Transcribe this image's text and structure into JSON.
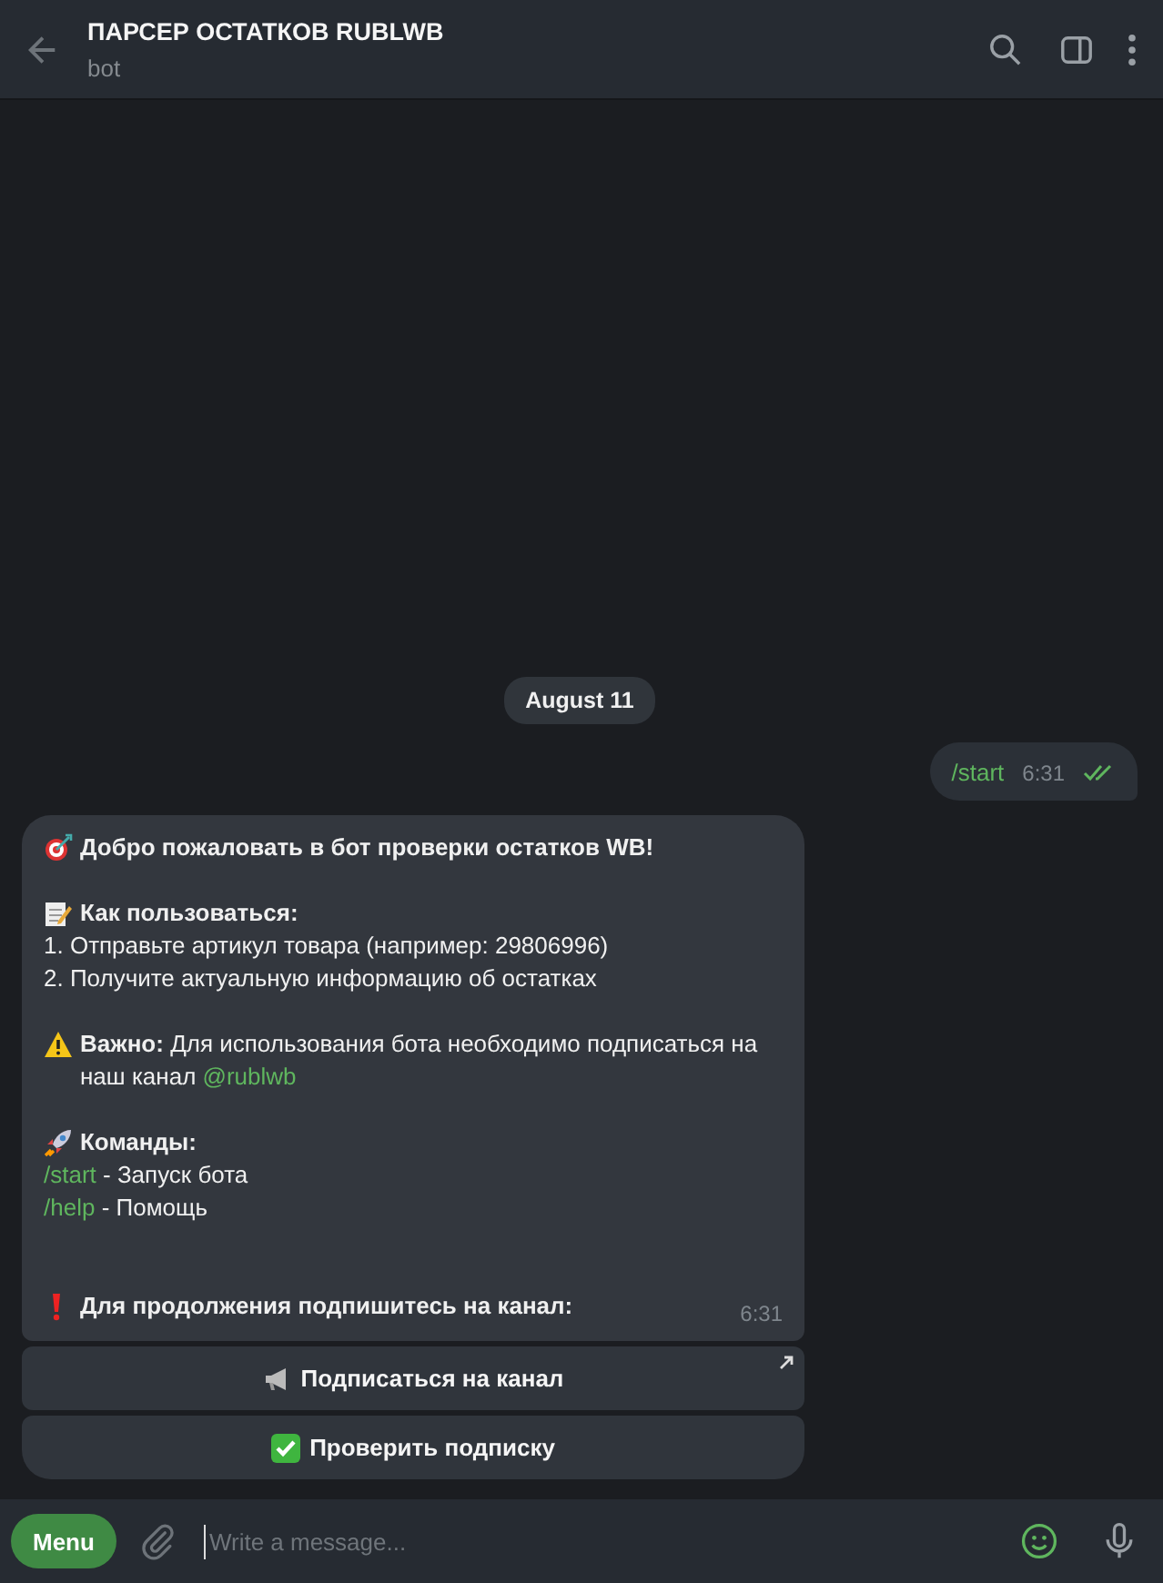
{
  "header": {
    "title": "ПАРСЕР ОСТАТКОВ RUBLWB",
    "subtitle": "bot"
  },
  "date": "August 11",
  "outgoing": {
    "text": "/start",
    "time": "6:31",
    "read": true
  },
  "incoming": {
    "time": "6:31",
    "blocks": [
      {
        "kind": "title",
        "text": "Добро пожаловать в бот проверки остатков WB!"
      },
      {
        "kind": "section",
        "heading": "Как пользоваться:",
        "lines": [
          "1. Отправьте артикул товара (например: 29806996)",
          "2. Получите актуальную информацию об остатках"
        ]
      },
      {
        "kind": "notice",
        "text": "**Важно:** Для использования бота необходимо подписаться на наш канал",
        "link": "@rublwb"
      },
      {
        "kind": "commands",
        "heading": "Команды:",
        "commands": [
          {
            "command": "/start",
            "description": "- Запуск бота"
          },
          {
            "command": "/help",
            "description": "- Помощь"
          }
        ]
      },
      {
        "kind": "alert",
        "text": "Для продолжения подпишитесь на канал:"
      }
    ],
    "buttons": [
      {
        "kind": "url",
        "label": "Подписаться на канал"
      },
      {
        "kind": "callback",
        "label": "Проверить подписку"
      }
    ]
  },
  "composer": {
    "menu": "Menu",
    "placeholder": "Write a message..."
  }
}
